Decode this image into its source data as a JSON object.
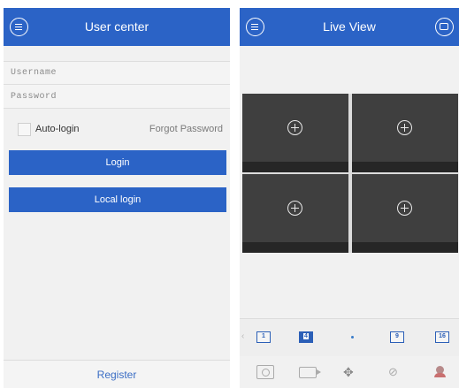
{
  "login_screen": {
    "header": {
      "title": "User center",
      "menu_icon": "menu-icon"
    },
    "username": {
      "placeholder": "Username",
      "value": ""
    },
    "password": {
      "placeholder": "Password",
      "value": ""
    },
    "auto_login": {
      "label": "Auto-login",
      "checked": false
    },
    "forgot_password": "Forgot Password",
    "login_button": "Login",
    "local_login_button": "Local login",
    "register": "Register"
  },
  "live_view": {
    "header": {
      "title": "Live View",
      "menu_icon": "menu-icon",
      "right_icon": "device-list-icon"
    },
    "cells": [
      {
        "icon": "add-channel-icon"
      },
      {
        "icon": "add-channel-icon"
      },
      {
        "icon": "add-channel-icon"
      },
      {
        "icon": "add-channel-icon"
      }
    ],
    "split_options": [
      "1",
      "4",
      "9",
      "16"
    ],
    "selected_split": "4",
    "toolbar": [
      "snapshot-icon",
      "record-icon",
      "ptz-icon",
      "mute-icon",
      "alarm-icon"
    ],
    "accent_color": "#2b63c6"
  }
}
